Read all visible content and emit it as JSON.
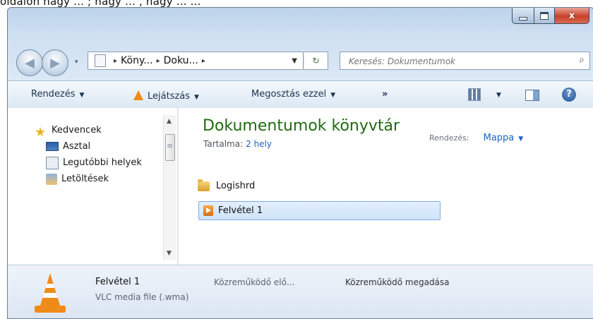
{
  "top_strip_text": "oldalon nagy ... ; nagy ... , nagy ... ...",
  "window": {
    "title_buttons": [
      "minimize",
      "maximize",
      "close"
    ],
    "close_glyph": "x"
  },
  "navigation": {
    "back_glyph": "◀",
    "forward_glyph": "▶",
    "breadcrumb": [
      "Köny...",
      "Doku..."
    ],
    "crumb_sep": "▸",
    "search_placeholder": "Keresés: Dokumentumok"
  },
  "toolbar": {
    "organize": "Rendezés",
    "play": "Lejátszás",
    "share": "Megosztás ezzel",
    "more": "»"
  },
  "nav_pane": {
    "favorites_label": "Kedvencek",
    "items": [
      {
        "label": "Asztal"
      },
      {
        "label": "Legutóbbi helyek"
      },
      {
        "label": "Letöltések"
      }
    ]
  },
  "library": {
    "title": "Dokumentumok könyvtár",
    "contents_label": "Tartalma:",
    "contents_value": "2 hely",
    "arrange_label": "Rendezés:",
    "arrange_value": "Mappa"
  },
  "files": [
    {
      "name": "Logishrd",
      "type": "folder"
    },
    {
      "name": "Felvétel 1",
      "type": "wma",
      "selected": true
    }
  ],
  "details": {
    "name": "Felvétel 1",
    "type": "VLC media file (.wma)",
    "prop_label": "Közreműködő elő...",
    "prop_action": "Közreműködő megadása"
  },
  "colors": {
    "library_title": "#1f6b10",
    "link": "#1b62c4",
    "close_button": "#c7412a",
    "vlc_orange": "#f08a18"
  },
  "icons": [
    "back-icon",
    "forward-icon",
    "page-icon",
    "refresh-icon",
    "search-icon",
    "vlc-cone-icon",
    "view-grid-icon",
    "preview-pane-icon",
    "help-icon",
    "star-icon",
    "desktop-icon",
    "recent-places-icon",
    "downloads-icon",
    "folder-icon",
    "wma-file-icon"
  ]
}
